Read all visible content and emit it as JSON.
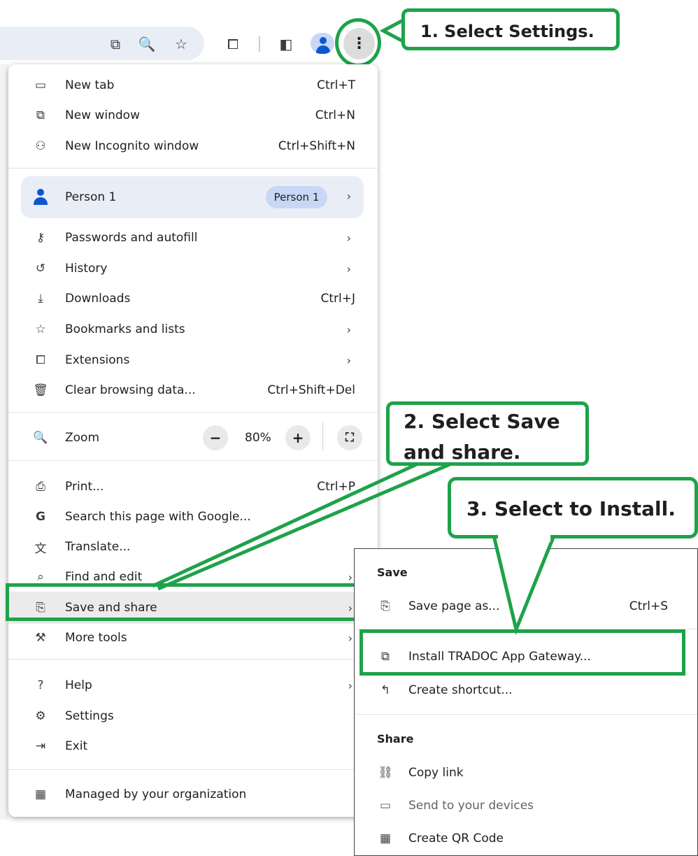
{
  "toolbar": {
    "icons": [
      "install-app-icon",
      "zoom-icon",
      "star-icon",
      "extensions-icon",
      "side-panel-icon",
      "profile-icon",
      "more-options-icon"
    ],
    "glyphs": {
      "install": "⧉",
      "zoom": "🔍",
      "star": "☆",
      "extensions": "⧠",
      "sidepanel": "◧",
      "more": "⋮"
    }
  },
  "menu": {
    "new_tab": {
      "label": "New tab",
      "shortcut": "Ctrl+T",
      "icon": "▭"
    },
    "new_window": {
      "label": "New window",
      "shortcut": "Ctrl+N",
      "icon": "⧉"
    },
    "new_incognito": {
      "label": "New Incognito window",
      "shortcut": "Ctrl+Shift+N",
      "icon": "⚇"
    },
    "person": {
      "label": "Person 1",
      "chip": "Person 1",
      "arrow": "›"
    },
    "passwords": {
      "label": "Passwords and autofill",
      "arrow": "›",
      "icon": "⚷"
    },
    "history": {
      "label": "History",
      "arrow": "›",
      "icon": "↺"
    },
    "downloads": {
      "label": "Downloads",
      "shortcut": "Ctrl+J",
      "icon": "⤓"
    },
    "bookmarks": {
      "label": "Bookmarks and lists",
      "arrow": "›",
      "icon": "☆"
    },
    "extensions": {
      "label": "Extensions",
      "arrow": "›",
      "icon": "⧠"
    },
    "clear_data": {
      "label": "Clear browsing data...",
      "shortcut": "Ctrl+Shift+Del",
      "icon": "🗑"
    },
    "zoom": {
      "label": "Zoom",
      "value": "80%",
      "minus": "−",
      "plus": "+",
      "fullscreen": "⛶",
      "icon": "🔍"
    },
    "print": {
      "label": "Print...",
      "shortcut": "Ctrl+P",
      "icon": "⎙"
    },
    "search_google": {
      "label": "Search this page with Google...",
      "icon": "G"
    },
    "translate": {
      "label": "Translate...",
      "icon": "文"
    },
    "find_edit": {
      "label": "Find and edit",
      "arrow": "›",
      "icon": "⌕"
    },
    "save_share": {
      "label": "Save and share",
      "arrow": "›",
      "icon": "⎘"
    },
    "more_tools": {
      "label": "More tools",
      "arrow": "›",
      "icon": "⚒"
    },
    "help": {
      "label": "Help",
      "arrow": "›",
      "icon": "?"
    },
    "settings": {
      "label": "Settings",
      "icon": "⚙"
    },
    "exit": {
      "label": "Exit",
      "icon": "⇥"
    },
    "managed": {
      "label": "Managed by your organization",
      "icon": "▦"
    }
  },
  "submenu": {
    "save_header": "Save",
    "save_page": {
      "label": "Save page as...",
      "shortcut": "Ctrl+S",
      "icon": "⎘"
    },
    "install_app": {
      "label": "Install TRADOC App Gateway...",
      "icon": "⧉"
    },
    "create_shortcut": {
      "label": "Create shortcut...",
      "icon": "↰"
    },
    "share_header": "Share",
    "copy_link": {
      "label": "Copy link",
      "icon": "⛓"
    },
    "send_devices": {
      "label": "Send to your devices",
      "icon": "▭"
    },
    "qr_code": {
      "label": "Create QR Code",
      "icon": "▦"
    }
  },
  "callouts": {
    "step1": "1. Select Settings.",
    "step2_line1": "2. Select Save",
    "step2_line2": "and share.",
    "step3": "3. Select to Install."
  },
  "colors": {
    "annotation_green": "#1ea24a",
    "accent_blue": "#0b57d0",
    "profile_chip": "#c8d7f5"
  }
}
